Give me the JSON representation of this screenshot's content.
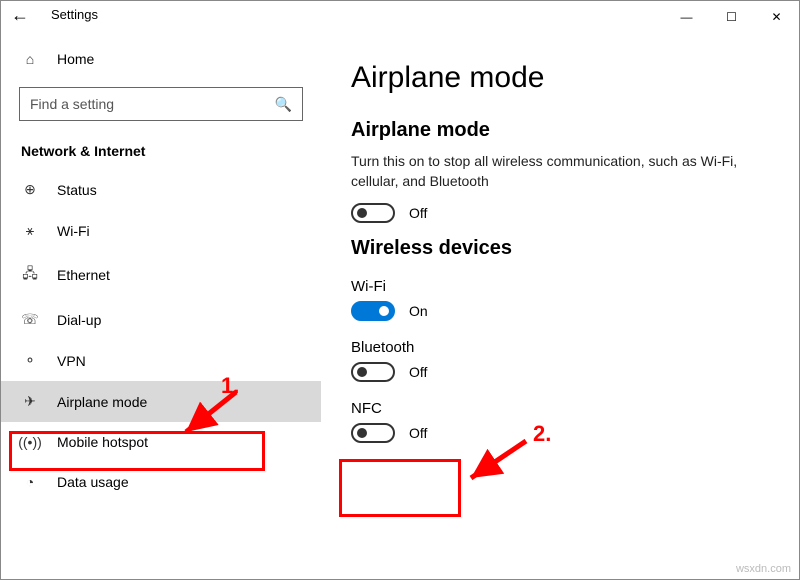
{
  "window": {
    "title": "Settings",
    "minimize": "—",
    "maximize": "☐",
    "close": "✕"
  },
  "sidebar": {
    "home": "Home",
    "search_placeholder": "Find a setting",
    "section": "Network & Internet",
    "items": [
      {
        "label": "Status",
        "icon": "⊕"
      },
      {
        "label": "Wi-Fi",
        "icon": "⚹"
      },
      {
        "label": "Ethernet",
        "icon": "🖧"
      },
      {
        "label": "Dial-up",
        "icon": "☏"
      },
      {
        "label": "VPN",
        "icon": "⚬"
      },
      {
        "label": "Airplane mode",
        "icon": "✈"
      },
      {
        "label": "Mobile hotspot",
        "icon": "((•))"
      },
      {
        "label": "Data usage",
        "icon": "◔"
      }
    ]
  },
  "main": {
    "title": "Airplane mode",
    "airplane_heading": "Airplane mode",
    "airplane_desc": "Turn this on to stop all wireless communication, such as Wi-Fi, cellular, and Bluetooth",
    "airplane_state": "Off",
    "wireless_heading": "Wireless devices",
    "wifi_label": "Wi-Fi",
    "wifi_state": "On",
    "bt_label": "Bluetooth",
    "bt_state": "Off",
    "nfc_label": "NFC",
    "nfc_state": "Off"
  },
  "annotations": {
    "label1": "1.",
    "label2": "2."
  },
  "watermark": "wsxdn.com"
}
